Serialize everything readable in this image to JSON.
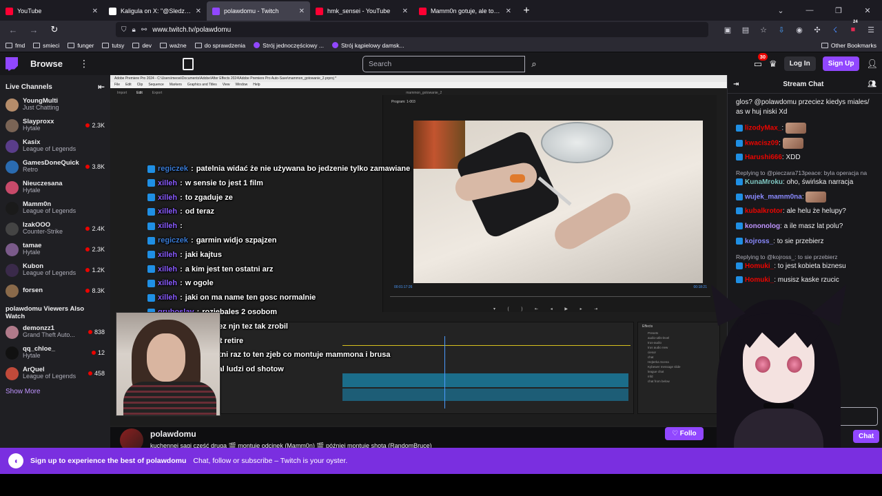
{
  "browser": {
    "tabs": [
      {
        "title": "YouTube",
        "color": "#ff0033",
        "active": false
      },
      {
        "title": "Kaligula on X: \"@SledziuStream",
        "color": "#ffffff",
        "active": false
      },
      {
        "title": "polawdomu - Twitch",
        "color": "#9147ff",
        "active": true
      },
      {
        "title": "hmk_sensei - YouTube",
        "color": "#ff0033",
        "active": false
      },
      {
        "title": "Mamm0n gotuje, ale to Konon",
        "color": "#ff0033",
        "active": false
      }
    ],
    "url": "www.twitch.tv/polawdomu",
    "bookmarks": [
      "fmd",
      "smieci",
      "funger",
      "tutsy",
      "dev",
      "ważne",
      "do sprawdzenia",
      "Strój jednoczęściowy ...",
      "Strój kąpielowy damsk..."
    ],
    "other_bookmarks": "Other Bookmarks",
    "ext_badge": "24"
  },
  "twitch": {
    "browse": "Browse",
    "search_placeholder": "Search",
    "notif_count": "30",
    "login": "Log In",
    "signup": "Sign Up"
  },
  "sidebar": {
    "title": "Live Channels",
    "channels": [
      {
        "name": "YoungMulti",
        "game": "Just Chatting",
        "viewers": "",
        "color": "#b58c6a"
      },
      {
        "name": "Slayproxx",
        "game": "Hytale",
        "viewers": "2.3K",
        "color": "#7a6455"
      },
      {
        "name": "Kasix",
        "game": "League of Legends",
        "viewers": "",
        "color": "#5a3d8a"
      },
      {
        "name": "GamesDoneQuick",
        "game": "Retro",
        "viewers": "3.8K",
        "color": "#2a6bb0"
      },
      {
        "name": "Nieuczesana",
        "game": "Hytale",
        "viewers": "",
        "color": "#c84a6a"
      },
      {
        "name": "Mamm0n",
        "game": "League of Legends",
        "viewers": "",
        "color": "#1a1a1a"
      },
      {
        "name": "IzakOOO",
        "game": "Counter-Strike",
        "viewers": "2.4K",
        "color": "#444"
      },
      {
        "name": "tamae",
        "game": "Hytale",
        "viewers": "2.3K",
        "color": "#7a5a8a"
      },
      {
        "name": "Kubon",
        "game": "League of Legends",
        "viewers": "1.2K",
        "color": "#3a2a4a"
      },
      {
        "name": "forsen",
        "game": "",
        "viewers": "8.3K",
        "color": "#8a6a4a"
      }
    ],
    "viewers_title": "polawdomu Viewers Also Watch",
    "also": [
      {
        "name": "demonzz1",
        "game": "Grand Theft Auto...",
        "viewers": "838",
        "color": "#b07a8a"
      },
      {
        "name": "qq_chloe_",
        "game": "Hytale",
        "viewers": "12",
        "color": "#111"
      },
      {
        "name": "ArQuel",
        "game": "League of Legends",
        "viewers": "458",
        "color": "#c04a3a"
      }
    ],
    "show_more": "Show More"
  },
  "premiere": {
    "titlebar": "Adobe Premiere Pro 2024 - C:\\Users\\meow\\Documents\\Adobe\\After Effects 2024\\Adobe Premiere Pro Auto-Save\\mammon_gotowanie_2.prproj *",
    "menu": [
      "File",
      "Edit",
      "Clip",
      "Sequence",
      "Markers",
      "Graphics and Titles",
      "View",
      "Window",
      "Help"
    ],
    "workspaces": [
      "Import",
      "Edit",
      "Export"
    ],
    "sequence": "mammon_gotowanie_2",
    "program": "Program: 1-003",
    "tc_in": "00:01:17:26",
    "tc_out": "00:18:21",
    "effects_title": "Effects",
    "effects": [
      "Presets",
      "audio-utils-level",
      "trus-audio",
      "trus audio new",
      "ciesor",
      "chat",
      "Hejterka Scena",
      "Kybewer message slide",
      "league chat",
      "mfd",
      "chat from below"
    ]
  },
  "overlay_chat": [
    {
      "user": "regiczek",
      "msg": "patelnia widać że nie używana bo jedzenie tylko zamawiane",
      "user_color": "#3a7bd5"
    },
    {
      "user": "xilleh",
      "msg": "w sensie to jest 1 film",
      "user_color": "#8a5cff"
    },
    {
      "user": "xilleh",
      "msg": "to zgaduje ze",
      "user_color": "#8a5cff"
    },
    {
      "user": "xilleh",
      "msg": "od teraz",
      "user_color": "#8a5cff"
    },
    {
      "user": "xilleh",
      "msg": "",
      "user_color": "#8a5cff"
    },
    {
      "user": "regiczek",
      "msg": "garmin widjo szpajzen",
      "user_color": "#3a7bd5"
    },
    {
      "user": "xilleh",
      "msg": "jaki kajtus",
      "user_color": "#8a5cff"
    },
    {
      "user": "xilleh",
      "msg": "a kim jest ten ostatni arz",
      "user_color": "#8a5cff"
    },
    {
      "user": "xilleh",
      "msg": "w ogole",
      "user_color": "#8a5cff"
    },
    {
      "user": "xilleh",
      "msg": "jaki on ma name ten gosc normalnie",
      "user_color": "#8a5cff"
    },
    {
      "user": "gruboslav",
      "msg": "rozjebales 2 osobom",
      "user_color": "#8a5cff"
    },
    {
      "user": "xilleh",
      "msg": "no przeciez njn tez tak zrobil",
      "user_color": "#8a5cff"
    },
    {
      "user": "xilleh",
      "msg": "i teraz jest retire",
      "user_color": "#8a5cff"
    },
    {
      "user": "desugame",
      "msg": "ostatni raz to ten zjeb co montuje mammona i brusa",
      "user_color": "#c0392b"
    },
    {
      "user": "xilleh",
      "msg": "bo tez mial ludzi od shotow",
      "user_color": "#8a5cff"
    }
  ],
  "stream": {
    "channel": "polawdomu",
    "title": "kuchennej sagi część druga 🎬 montuje odcinek (Mamm0n) 🎬 później montuje shota (RandomBruce)",
    "follow": "Follo"
  },
  "chat": {
    "title": "Stream Chat",
    "messages": [
      {
        "reply": "",
        "user": "",
        "text": "glos? @polawdomu przeciez kiedys miales/ as w huj niski Xd",
        "user_color": "#efeff1"
      },
      {
        "reply": "",
        "user": "lizodyMax_",
        "text": "",
        "user_color": "#eb0400",
        "emote": true
      },
      {
        "reply": "",
        "user": "kwacisz09",
        "text": "",
        "user_color": "#eb0400",
        "emote": true
      },
      {
        "reply": "",
        "user": "Harushi666",
        "text": "XDD",
        "user_color": "#eb0400"
      },
      {
        "reply": "Replying to @pieczara713peace: byla operacja na",
        "user": "KunaMroku",
        "text": "oho, świńska narracja",
        "user_color": "#7fc7c2"
      },
      {
        "reply": "",
        "user": "wujek_mamm0na",
        "text": "",
        "user_color": "#8a8aff",
        "emote": true
      },
      {
        "reply": "",
        "user": "kubalkrotor",
        "text": "ale helu że helupy?",
        "user_color": "#eb0400"
      },
      {
        "reply": "",
        "user": "kononolog",
        "text": "a ile masz lat polu?",
        "user_color": "#bf94ff"
      },
      {
        "reply": "",
        "user": "kojross_",
        "text": "to sie przebierz",
        "user_color": "#8a8aff"
      },
      {
        "reply": "Replying to @kojross_: to sie przebierz",
        "user": "Homuki_",
        "text": "to jest kobieta biznesu",
        "user_color": "#eb0400"
      },
      {
        "reply": "",
        "user": "Homuki_",
        "text": "musisz kaske rzucic",
        "user_color": "#eb0400"
      }
    ],
    "input_placeholder": "Send a message",
    "chat_button": "Chat"
  },
  "banner": {
    "strong": "Sign up to experience the best of polawdomu",
    "text": "Chat, follow or subscribe – Twitch is your oyster."
  }
}
